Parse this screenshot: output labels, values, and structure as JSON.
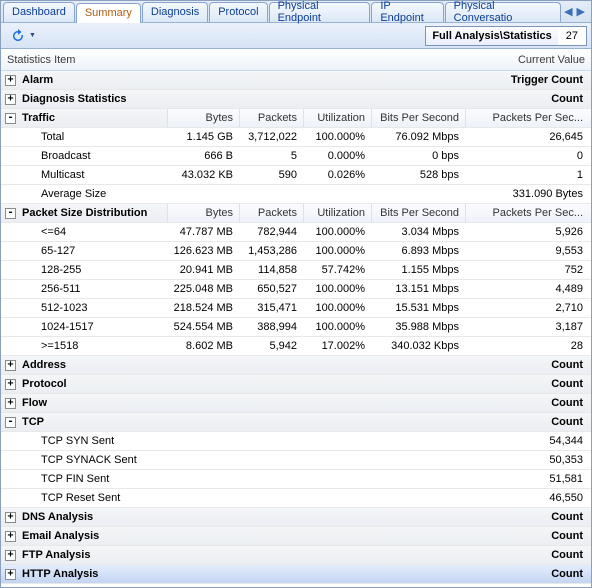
{
  "tabs": [
    "Dashboard",
    "Summary",
    "Diagnosis",
    "Protocol",
    "Physical Endpoint",
    "IP Endpoint",
    "Physical Conversatio"
  ],
  "activeTab": 1,
  "breadcrumb": "Full Analysis\\Statistics",
  "breadcrumb_count": "27",
  "header": {
    "left": "Statistics Item",
    "right": "Current Value"
  },
  "cols": [
    "Bytes",
    "Packets",
    "Utilization",
    "Bits Per Second",
    "Packets Per Sec..."
  ],
  "count_label": "Count",
  "trigger_label": "Trigger Count",
  "groups": {
    "alarm": "Alarm",
    "diag": "Diagnosis Statistics",
    "traffic": "Traffic",
    "pkt": "Packet Size Distribution",
    "addr": "Address",
    "proto": "Protocol",
    "flow": "Flow",
    "tcp": "TCP",
    "dns": "DNS Analysis",
    "email": "Email Analysis",
    "ftp": "FTP Analysis",
    "http": "HTTP Analysis"
  },
  "traffic": {
    "rows": [
      {
        "label": "Total",
        "bytes": "1.145 GB",
        "packets": "3,712,022",
        "util": "100.000%",
        "bps": "76.092 Mbps",
        "pps": "26,645"
      },
      {
        "label": "Broadcast",
        "bytes": "666 B",
        "packets": "5",
        "util": "0.000%",
        "bps": "0 bps",
        "pps": "0"
      },
      {
        "label": "Multicast",
        "bytes": "43.032 KB",
        "packets": "590",
        "util": "0.026%",
        "bps": "528 bps",
        "pps": "1"
      }
    ],
    "avg_label": "Average Size",
    "avg_value": "331.090 Bytes"
  },
  "pkt": {
    "rows": [
      {
        "label": "<=64",
        "bytes": "47.787 MB",
        "packets": "782,944",
        "util": "100.000%",
        "bps": "3.034 Mbps",
        "pps": "5,926"
      },
      {
        "label": "65-127",
        "bytes": "126.623 MB",
        "packets": "1,453,286",
        "util": "100.000%",
        "bps": "6.893 Mbps",
        "pps": "9,553"
      },
      {
        "label": "128-255",
        "bytes": "20.941 MB",
        "packets": "114,858",
        "util": "57.742%",
        "bps": "1.155 Mbps",
        "pps": "752"
      },
      {
        "label": "256-511",
        "bytes": "225.048 MB",
        "packets": "650,527",
        "util": "100.000%",
        "bps": "13.151 Mbps",
        "pps": "4,489"
      },
      {
        "label": "512-1023",
        "bytes": "218.524 MB",
        "packets": "315,471",
        "util": "100.000%",
        "bps": "15.531 Mbps",
        "pps": "2,710"
      },
      {
        "label": "1024-1517",
        "bytes": "524.554 MB",
        "packets": "388,994",
        "util": "100.000%",
        "bps": "35.988 Mbps",
        "pps": "3,187"
      },
      {
        "label": ">=1518",
        "bytes": "8.602 MB",
        "packets": "5,942",
        "util": "17.002%",
        "bps": "340.032 Kbps",
        "pps": "28"
      }
    ]
  },
  "tcp": {
    "rows": [
      {
        "label": "TCP SYN Sent",
        "value": "54,344"
      },
      {
        "label": "TCP SYNACK Sent",
        "value": "50,353"
      },
      {
        "label": "TCP FIN Sent",
        "value": "51,581"
      },
      {
        "label": "TCP Reset Sent",
        "value": "46,550"
      }
    ]
  }
}
